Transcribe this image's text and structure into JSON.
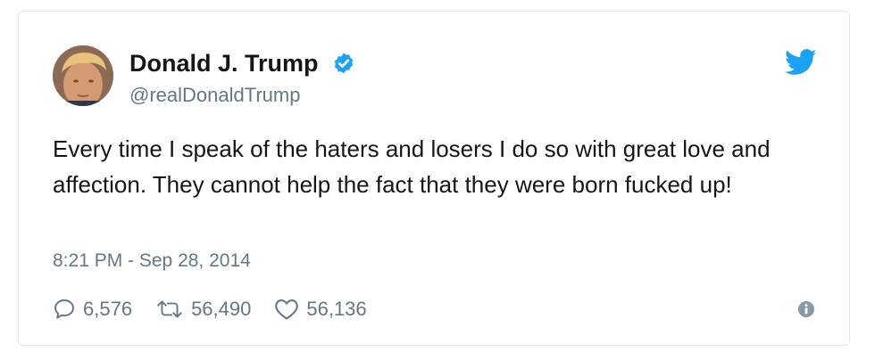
{
  "tweet": {
    "author_name": "Donald J. Trump",
    "author_handle": "@realDonaldTrump",
    "verified": true,
    "text": "Every time I speak of the haters and losers I do so with great love and affection. They cannot help the fact that they were born fucked up!",
    "timestamp": "8:21 PM - Sep 28, 2014",
    "replies": "6,576",
    "retweets": "56,490",
    "likes": "56,136"
  },
  "icons": {
    "verified": "verified-badge-icon",
    "brand": "twitter-bird-icon",
    "reply": "speech-bubble-icon",
    "retweet": "retweet-arrows-icon",
    "like": "heart-icon",
    "info": "info-icon"
  },
  "colors": {
    "brand_blue": "#1da1f2",
    "muted_text": "#657786",
    "primary_text": "#14171a",
    "border": "#e1e8ed"
  }
}
